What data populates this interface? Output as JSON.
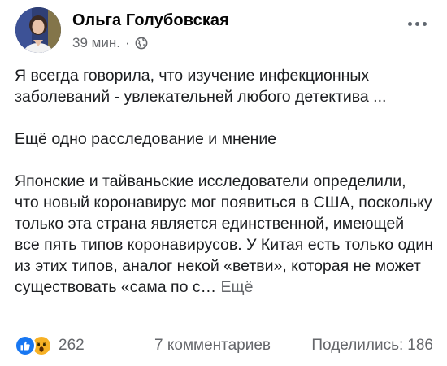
{
  "post": {
    "author": "Ольга Голубовская",
    "time": "39 мин.",
    "separator": "·",
    "privacy_icon": "globe-icon",
    "more_icon": "more-options-icon",
    "paragraphs": [
      "Я всегда говорила, что изучение инфекционных заболеваний - увлекательней любого детектива ...",
      "Ещё одно расследование и мнение",
      "Японские и тайваньские исследователи определили, что новый коронавирус мог появиться в США, поскольку только эта страна является единственной, имеющей все пять типов коронавирусов. У Китая есть только один из этих типов, аналог некой «ветви», которая не может существовать «сама по с…"
    ],
    "see_more": "Ещё"
  },
  "footer": {
    "reaction_icons": [
      "like-reaction-icon",
      "wow-reaction-icon"
    ],
    "reactions_count": "262",
    "comments": "7 комментариев",
    "shares_label": "Поделились:",
    "shares_count": "186"
  },
  "colors": {
    "like": "#1877f2",
    "wow": "#f7b125",
    "secondary_text": "#65676b"
  }
}
